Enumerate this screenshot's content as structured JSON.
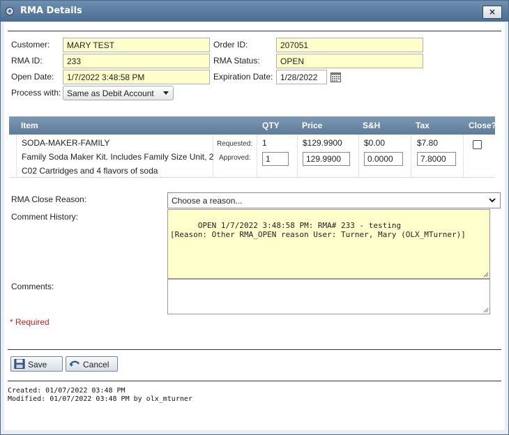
{
  "window": {
    "title": "RMA Details",
    "close_label": "×"
  },
  "form": {
    "customer_label": "Customer:",
    "customer_value": "MARY TEST",
    "rma_id_label": "RMA ID:",
    "rma_id_value": "233",
    "open_date_label": "Open Date:",
    "open_date_value": "1/7/2022 3:48:58 PM",
    "process_label": "Process with:",
    "process_value": "Same as Debit Account",
    "order_id_label": "Order ID:",
    "order_id_value": "207051",
    "rma_status_label": "RMA Status:",
    "rma_status_value": "OPEN",
    "expiration_label": "Expiration Date:",
    "expiration_value": "1/28/2022"
  },
  "table": {
    "headers": [
      "Item",
      "QTY",
      "Price",
      "S&H",
      "Tax",
      "Close?"
    ],
    "row": {
      "item_code": "SODA-MAKER-FAMILY",
      "item_desc_1": "Family Soda Maker Kit. Includes Family Size Unit, 2",
      "item_desc_2": "C02 Cartridges and 4 flavors of soda",
      "requested_label": "Requested:",
      "approved_label": "Approved:",
      "qty_requested": "1",
      "qty_approved": "1",
      "price_requested": "$129.9900",
      "price_approved": "129.9900",
      "sh_requested": "$0.00",
      "sh_approved": "0.0000",
      "tax_requested": "$7.80",
      "tax_approved": "7.8000",
      "close_checked": false
    }
  },
  "close_reason": {
    "label": "RMA Close Reason:",
    "placeholder": "Choose a reason..."
  },
  "comment_history": {
    "label": "Comment History:",
    "text": "OPEN 1/7/2022 3:48:58 PM: RMA# 233 - testing\n[Reason: Other RMA_OPEN reason User: Turner, Mary (OLX_MTurner)]"
  },
  "comments": {
    "label": "Comments:",
    "value": ""
  },
  "required_note": "* Required",
  "buttons": {
    "save": "Save",
    "cancel": "Cancel"
  },
  "footer": {
    "created": "Created: 01/07/2022 03:48 PM",
    "modified": "Modified: 01/07/2022 03:48 PM by olx_mturner"
  },
  "colors": {
    "highlight_field": "#ffffcc",
    "header_blue": "#5d7c9b",
    "required_red": "#cc2020"
  }
}
